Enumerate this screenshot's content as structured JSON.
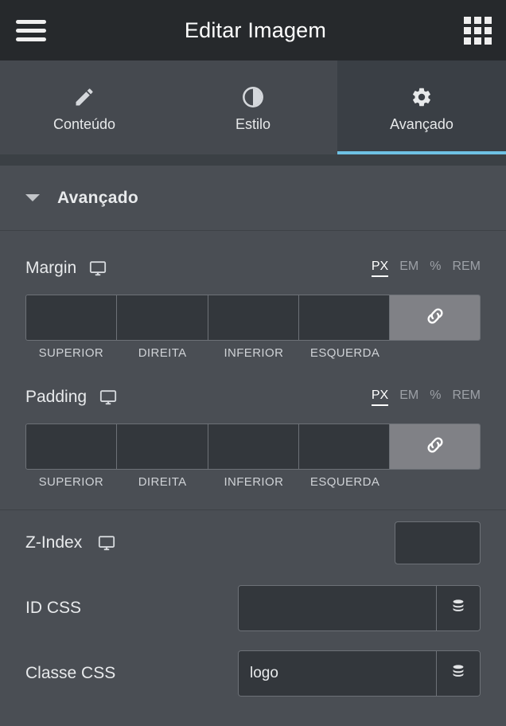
{
  "topbar": {
    "menu_icon": "hamburger-menu-icon",
    "title": "Editar Imagem",
    "apps_icon": "apps-grid-icon"
  },
  "tabs": [
    {
      "label": "Conteúdo",
      "icon": "pencil-icon",
      "active": false
    },
    {
      "label": "Estilo",
      "icon": "contrast-circle-icon",
      "active": false
    },
    {
      "label": "Avançado",
      "icon": "gear-icon",
      "active": true
    }
  ],
  "section": {
    "title": "Avançado",
    "collapse_icon": "chevron-down-icon"
  },
  "margin": {
    "label": "Margin",
    "device_icon": "desktop-monitor-icon",
    "units": [
      "PX",
      "EM",
      "%",
      "REM"
    ],
    "active_unit": "PX",
    "values": [
      "",
      "",
      "",
      ""
    ],
    "placeholders": [
      "",
      "",
      "",
      ""
    ],
    "side_labels": [
      "SUPERIOR",
      "DIREITA",
      "INFERIOR",
      "ESQUERDA"
    ],
    "link_icon": "link-chain-icon",
    "link_active": true
  },
  "padding": {
    "label": "Padding",
    "device_icon": "desktop-monitor-icon",
    "units": [
      "PX",
      "EM",
      "%",
      "REM"
    ],
    "active_unit": "PX",
    "values": [
      "",
      "",
      "",
      ""
    ],
    "placeholders": [
      "",
      "",
      "",
      ""
    ],
    "side_labels": [
      "SUPERIOR",
      "DIREITA",
      "INFERIOR",
      "ESQUERDA"
    ],
    "link_icon": "link-chain-icon",
    "link_active": true
  },
  "zindex": {
    "label": "Z-Index",
    "device_icon": "desktop-monitor-icon",
    "value": "",
    "placeholder": ""
  },
  "css_id": {
    "label": "ID CSS",
    "value": "",
    "placeholder": "",
    "dynamic_icon": "database-stack-icon"
  },
  "css_class": {
    "label": "Classe CSS",
    "value": "logo",
    "placeholder": "",
    "dynamic_icon": "database-stack-icon"
  },
  "colors": {
    "topbar_bg": "#26292c",
    "tabs_bg": "#45494f",
    "active_tab_bg": "#3a3f45",
    "accent": "#6ec1e4",
    "panel_bg": "#4a4e54",
    "input_bg": "#33373c",
    "border": "#6d7177",
    "link_active_bg": "#808186",
    "text": "#e8eaec",
    "muted_text": "#9ca0a6"
  }
}
